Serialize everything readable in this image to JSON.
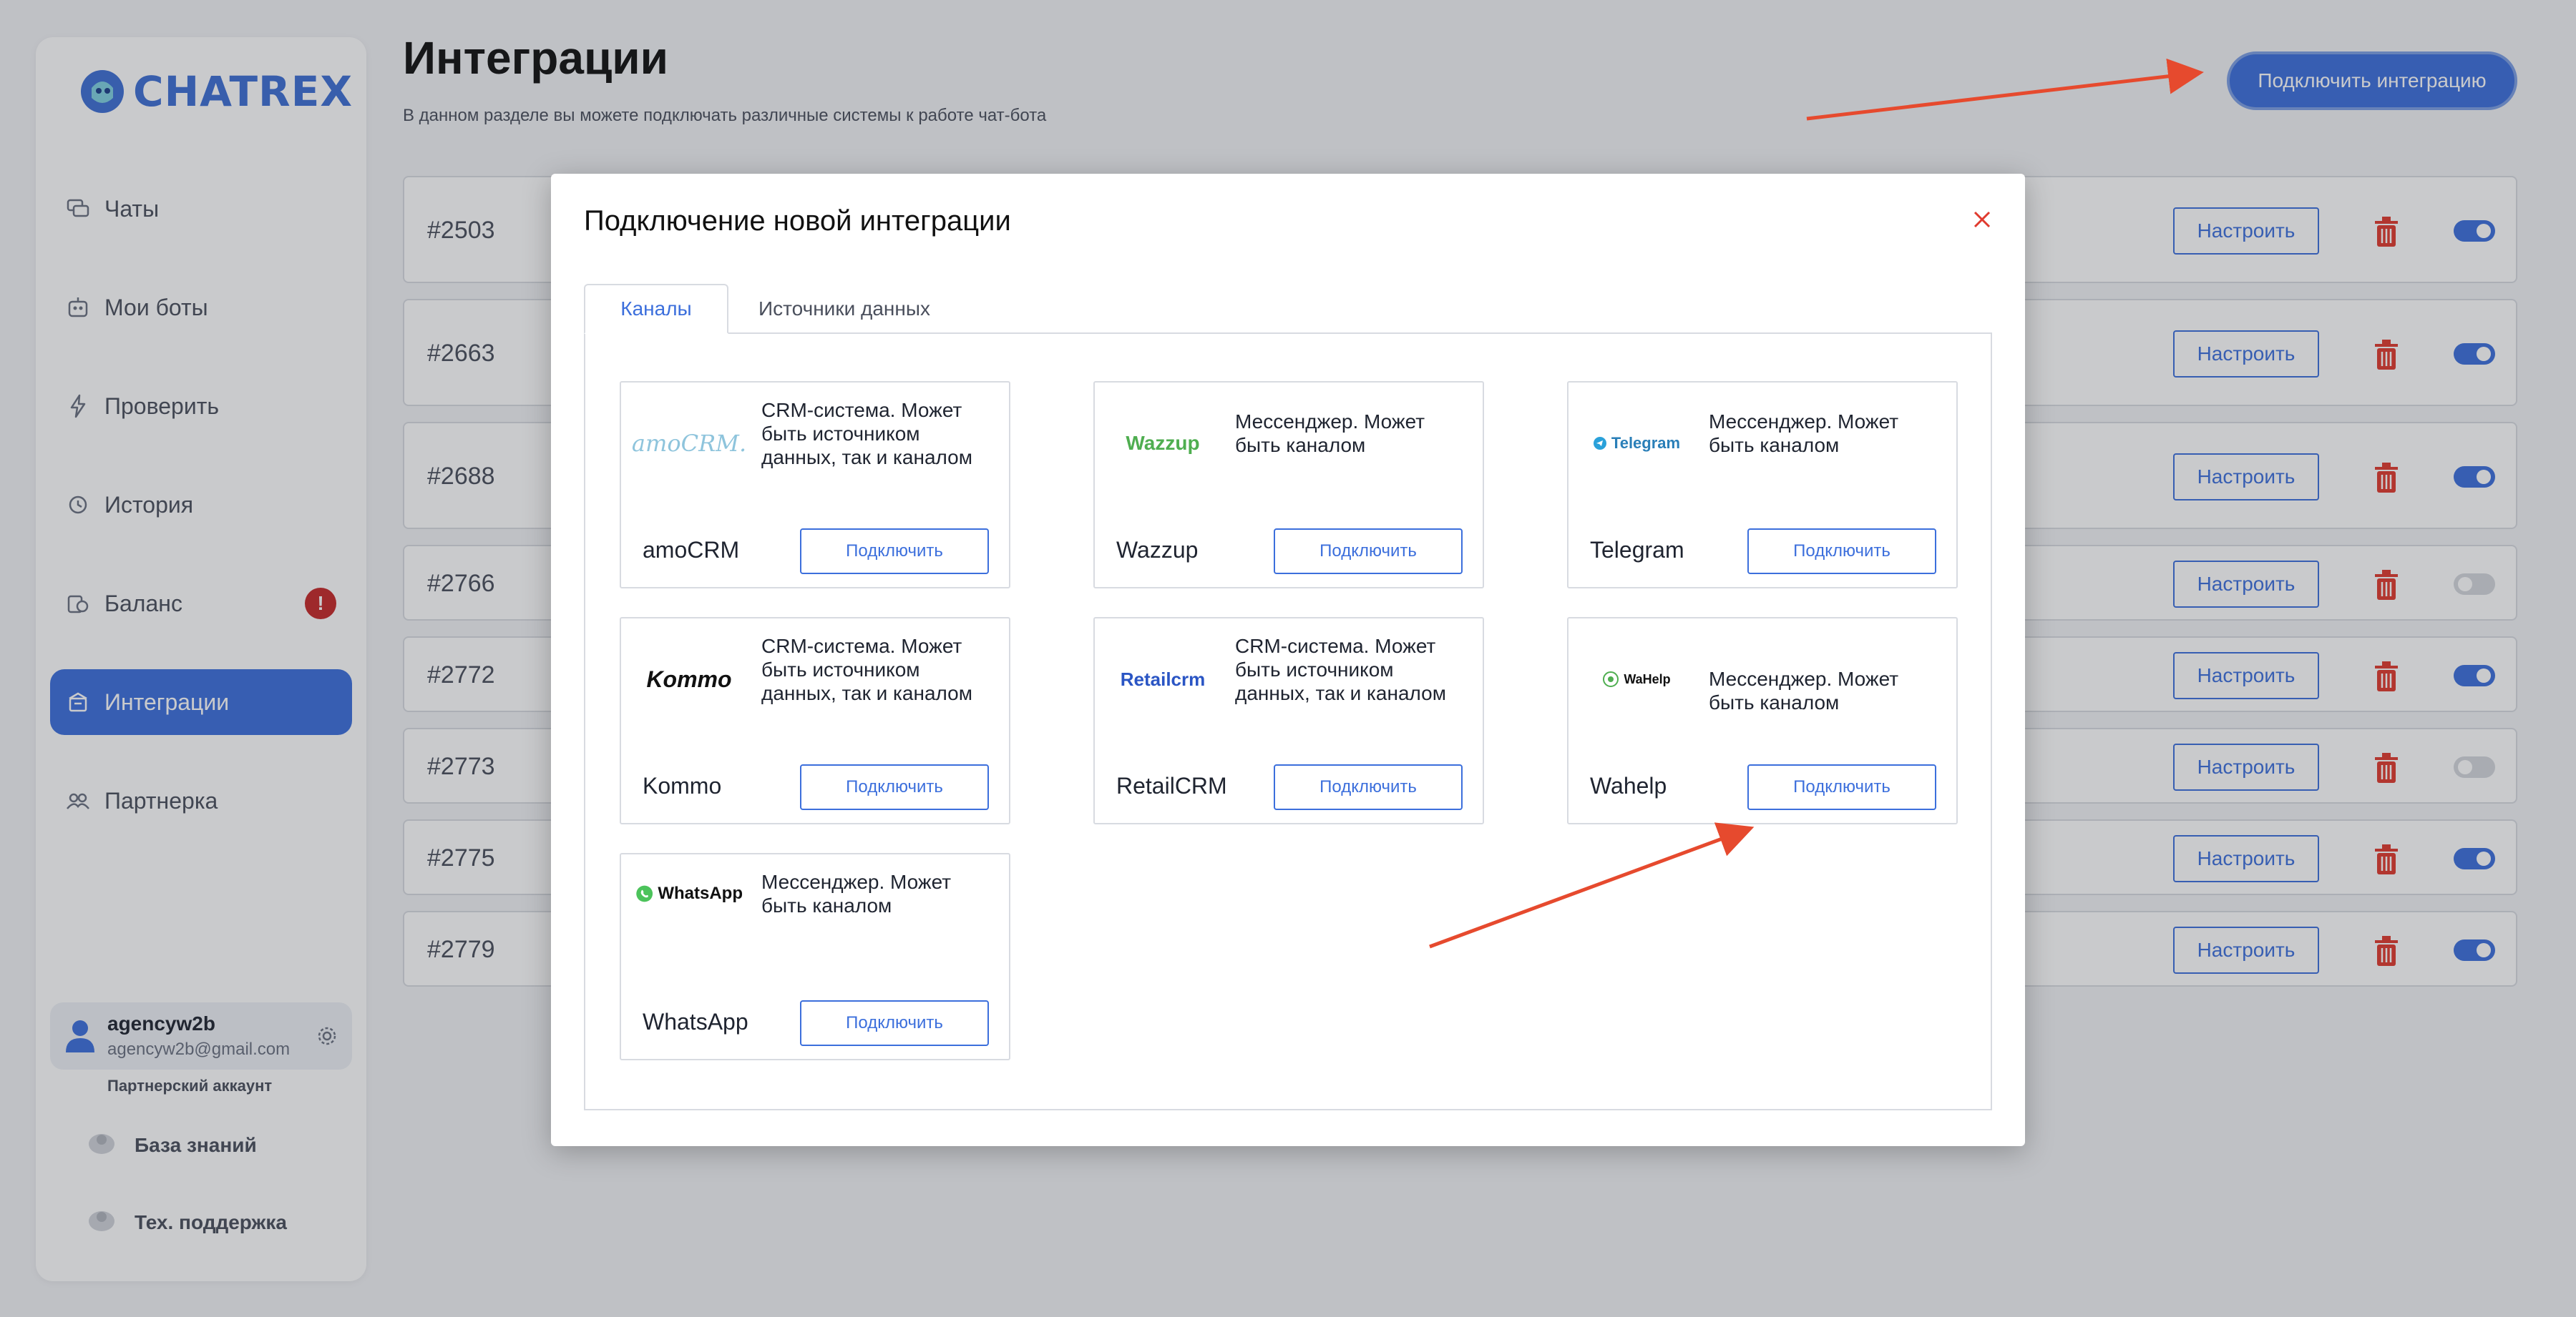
{
  "sidebar": {
    "logo_text": "CHATREX",
    "items": [
      {
        "label": "Чаты",
        "icon": "chat-icon"
      },
      {
        "label": "Мои боты",
        "icon": "bot-icon"
      },
      {
        "label": "Проверить",
        "icon": "lightning-icon"
      },
      {
        "label": "История",
        "icon": "history-icon"
      },
      {
        "label": "Баланс",
        "icon": "wallet-icon",
        "badge": "!"
      },
      {
        "label": "Интеграции",
        "icon": "integrations-icon",
        "active": true
      },
      {
        "label": "Партнерка",
        "icon": "partners-icon"
      }
    ],
    "user": {
      "name": "agencyw2b",
      "email": "agencyw2b@gmail.com",
      "account_type": "Партнерский аккаунт"
    },
    "footer": {
      "knowledge_base": "База знаний",
      "support": "Тех. поддержка"
    }
  },
  "header": {
    "title": "Интеграции",
    "subtitle": "В данном разделе вы можете подключать различные системы к работе чат-бота",
    "connect_button": "Подключить интеграцию"
  },
  "integrations": [
    {
      "id": "#2503",
      "enabled": true
    },
    {
      "id": "#2663",
      "enabled": true
    },
    {
      "id": "#2688",
      "enabled": true
    },
    {
      "id": "#2766",
      "enabled": false
    },
    {
      "id": "#2772",
      "enabled": true
    },
    {
      "id": "#2773",
      "enabled": false
    },
    {
      "id": "#2775",
      "enabled": true
    },
    {
      "id": "#2779",
      "enabled": true
    }
  ],
  "configure_label": "Настроить",
  "modal": {
    "title": "Подключение новой интеграции",
    "tabs": [
      "Каналы",
      "Источники данных"
    ],
    "connect_label": "Подключить",
    "cards": [
      {
        "name": "amoCRM",
        "logo": "amoCRM.",
        "description": "CRM-система. Может быть источником данных, так и каналом"
      },
      {
        "name": "Wazzup",
        "logo": "Wazzup",
        "description": "Мессенджер. Может быть каналом"
      },
      {
        "name": "Telegram",
        "logo": "Telegram",
        "description": "Мессенджер. Может быть каналом"
      },
      {
        "name": "Kommo",
        "logo": "Kommo",
        "description": "CRM-система. Может быть источником данных, так и каналом"
      },
      {
        "name": "RetailCRM",
        "logo": "Retailcrm",
        "description": "CRM-система. Может быть источником данных, так и каналом"
      },
      {
        "name": "Wahelp",
        "logo": "WaHelp",
        "description": "Мессенджер. Может быть каналом"
      },
      {
        "name": "WhatsApp",
        "logo": "WhatsApp",
        "description": "Мессенджер. Может быть каналом"
      }
    ]
  },
  "colors": {
    "accent": "#3c6fdc",
    "danger": "#e03a2e",
    "arrow": "#e64a2e"
  }
}
